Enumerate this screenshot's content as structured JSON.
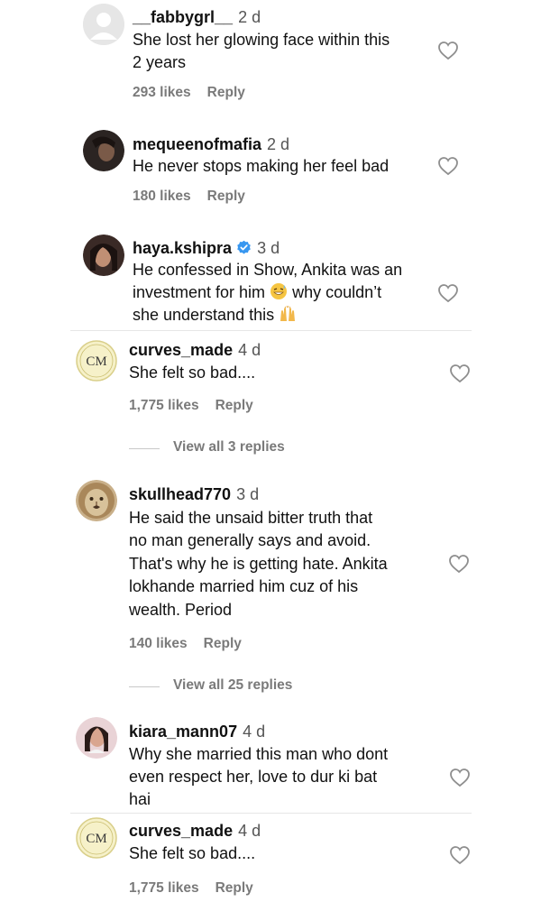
{
  "comments": [
    {
      "username": "__fabbygrl__",
      "time": "2 d",
      "lines": [
        "She lost her glowing face within this",
        "2 years"
      ],
      "likes": "293 likes",
      "reply": "Reply",
      "avatar_icon": "default-avatar-icon"
    },
    {
      "username": "mequeenofmafia",
      "time": "2 d",
      "lines": [
        "He never stops making her feel bad"
      ],
      "likes": "180 likes",
      "reply": "Reply",
      "avatar_icon": "profile-photo"
    },
    {
      "username": "haya.kshipra",
      "verified": true,
      "time": "3 d",
      "lines": [
        "He confessed in Show, Ankita was an",
        "investment for him",
        "why couldn’t",
        "she understand this"
      ],
      "emojis": [
        "grinning-sweat-emoji",
        "raising-hands-emoji"
      ],
      "likes": "",
      "reply": "",
      "avatar_icon": "profile-photo"
    },
    {
      "username": "curves_made",
      "time": "4 d",
      "lines": [
        "She felt so bad...."
      ],
      "likes": "1,775 likes",
      "reply": "Reply",
      "view_replies": "View all 3 replies",
      "avatar_icon": "cm-logo",
      "avatar_text": "CM"
    },
    {
      "username": "skullhead770",
      "time": "3 d",
      "lines": [
        "He said the unsaid bitter truth that",
        "no man generally says and avoid.",
        "That's why he is getting hate. Ankita",
        "lokhande married him cuz of his",
        "wealth. Period"
      ],
      "likes": "140 likes",
      "reply": "Reply",
      "view_replies": "View all 25 replies",
      "avatar_icon": "lion-photo"
    },
    {
      "username": "kiara_mann07",
      "time": "4 d",
      "lines": [
        "Why she married this man who dont",
        "even respect her, love to dur ki bat",
        "hai"
      ],
      "likes": "",
      "reply": "",
      "avatar_icon": "profile-photo"
    },
    {
      "username": "curves_made",
      "time": "4 d",
      "lines": [
        "She felt so bad...."
      ],
      "likes": "1,775 likes",
      "reply": "Reply",
      "avatar_icon": "cm-logo",
      "avatar_text": "CM"
    }
  ],
  "colors": {
    "text": "#111111",
    "meta": "#7a7a7a",
    "verified": "#3897f0",
    "heart_outline": "#8e8e8e"
  }
}
